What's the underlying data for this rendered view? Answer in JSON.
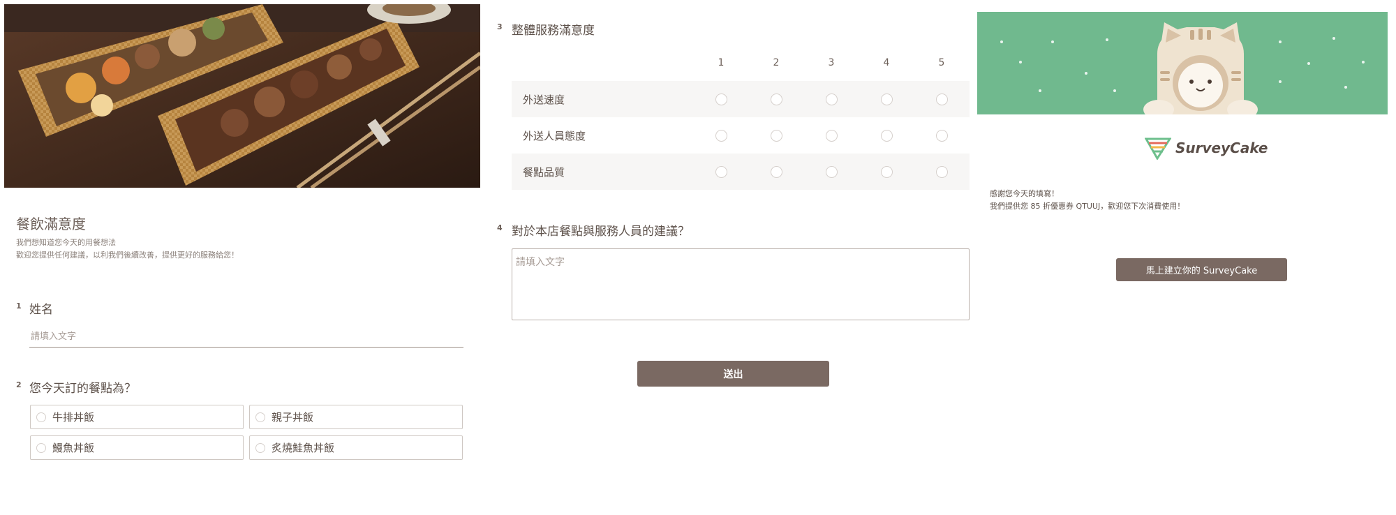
{
  "colors": {
    "accent_brown": "#7a6962",
    "text_brown": "#5e524b",
    "banner_green": "#70b98e",
    "row_shade": "#f7f6f5"
  },
  "survey": {
    "title": "餐飲滿意度",
    "description_lines": [
      "我們想知道您今天的用餐想法",
      "歡迎您提供任何建議，以利我們後續改善，提供更好的服務給您！"
    ],
    "hero_image": "bento-box-photo"
  },
  "questions": [
    {
      "number": "1",
      "title": "姓名",
      "type": "text",
      "placeholder": "請填入文字"
    },
    {
      "number": "2",
      "title": "您今天訂的餐點為？",
      "type": "single-choice",
      "options": [
        "牛排丼飯",
        "親子丼飯",
        "鰻魚丼飯",
        "炙燒鮭魚丼飯"
      ]
    },
    {
      "number": "3",
      "title": "整體服務滿意度",
      "type": "matrix",
      "scale": [
        "1",
        "2",
        "3",
        "4",
        "5"
      ],
      "rows": [
        "外送速度",
        "外送人員態度",
        "餐點品質"
      ]
    },
    {
      "number": "4",
      "title": "對於本店餐點與服務人員的建議？",
      "type": "textarea",
      "placeholder": "請填入文字"
    }
  ],
  "submit": {
    "label": "送出"
  },
  "thank_you": {
    "brand": "SurveyCake",
    "lines": [
      "感謝您今天的填寫！",
      "我們提供您 85 折優惠券 QTUUJ，歡迎您下次消費使用！"
    ],
    "cta_label": "馬上建立你的 SurveyCake",
    "banner_icon": "cat-mascot-icon"
  }
}
